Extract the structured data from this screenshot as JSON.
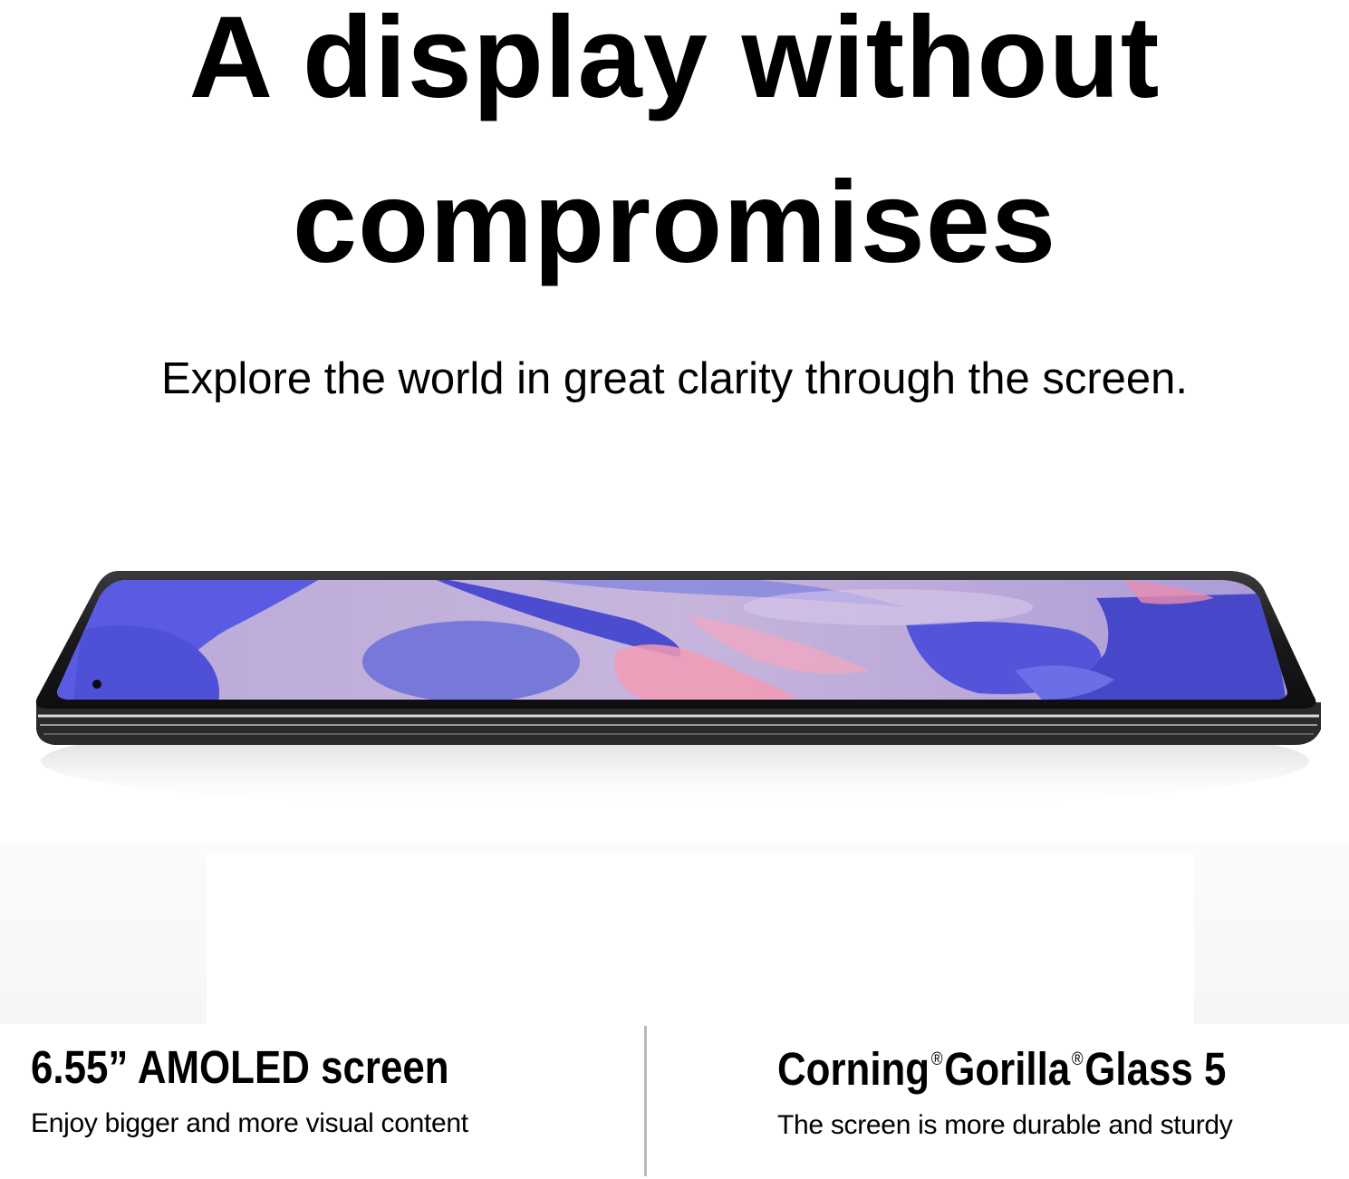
{
  "headline": {
    "line1": "A display without",
    "line2": "compromises"
  },
  "subheadline": "Explore the world in great clarity through the screen.",
  "features": [
    {
      "title": "6.55” AMOLED screen",
      "description": "Enjoy bigger and more visual content"
    },
    {
      "title_part1": "Corning",
      "registered_mark": "®",
      "title_part2": "Gorilla",
      "title_part3": "Glass 5",
      "description": "The screen is more durable and sturdy"
    }
  ],
  "colors": {
    "background": "#ffffff",
    "text": "#000000",
    "divider": "#b8b8b8",
    "screen_blue": "#5b5ce0",
    "screen_lilac": "#c9b8e0",
    "screen_pink": "#f08aa8",
    "phone_frame": "#1b1b1d"
  }
}
